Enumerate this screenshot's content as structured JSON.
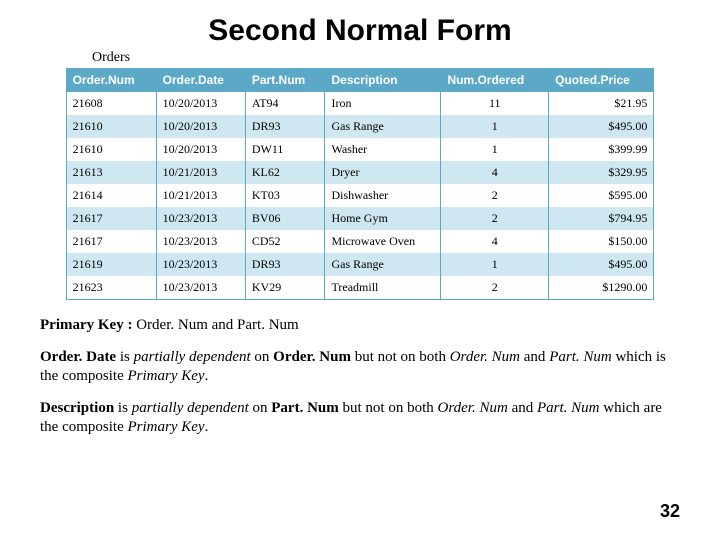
{
  "title": "Second Normal Form",
  "tableCaption": "Orders",
  "headers": [
    "Order.Num",
    "Order.Date",
    "Part.Num",
    "Description",
    "Num.Ordered",
    "Quoted.Price"
  ],
  "rows": [
    {
      "orderNum": "21608",
      "orderDate": "10/20/2013",
      "partNum": "AT94",
      "description": "Iron",
      "numOrdered": "11",
      "quotedPrice": "$21.95"
    },
    {
      "orderNum": "21610",
      "orderDate": "10/20/2013",
      "partNum": "DR93",
      "description": "Gas Range",
      "numOrdered": "1",
      "quotedPrice": "$495.00"
    },
    {
      "orderNum": "21610",
      "orderDate": "10/20/2013",
      "partNum": "DW11",
      "description": "Washer",
      "numOrdered": "1",
      "quotedPrice": "$399.99"
    },
    {
      "orderNum": "21613",
      "orderDate": "10/21/2013",
      "partNum": "KL62",
      "description": "Dryer",
      "numOrdered": "4",
      "quotedPrice": "$329.95"
    },
    {
      "orderNum": "21614",
      "orderDate": "10/21/2013",
      "partNum": "KT03",
      "description": "Dishwasher",
      "numOrdered": "2",
      "quotedPrice": "$595.00"
    },
    {
      "orderNum": "21617",
      "orderDate": "10/23/2013",
      "partNum": "BV06",
      "description": "Home Gym",
      "numOrdered": "2",
      "quotedPrice": "$794.95"
    },
    {
      "orderNum": "21617",
      "orderDate": "10/23/2013",
      "partNum": "CD52",
      "description": "Microwave Oven",
      "numOrdered": "4",
      "quotedPrice": "$150.00"
    },
    {
      "orderNum": "21619",
      "orderDate": "10/23/2013",
      "partNum": "DR93",
      "description": "Gas Range",
      "numOrdered": "1",
      "quotedPrice": "$495.00"
    },
    {
      "orderNum": "21623",
      "orderDate": "10/23/2013",
      "partNum": "KV29",
      "description": "Treadmill",
      "numOrdered": "2",
      "quotedPrice": "$1290.00"
    }
  ],
  "p1": {
    "t1": "Primary Key :",
    "t2": " Order. Num and Part. Num"
  },
  "p2": {
    "t1": "Order. Date ",
    "t2": "is ",
    "t3": "partially dependent ",
    "t4": "on ",
    "t5": "Order. Num ",
    "t6": "but not on both ",
    "t7": "Order. Num ",
    "t8": "and ",
    "t9": "Part. Num ",
    "t10": "which is the composite ",
    "t11": "Primary Key",
    "t12": "."
  },
  "p3": {
    "t1": "Description ",
    "t2": "is ",
    "t3": "partially dependent ",
    "t4": "on ",
    "t5": "Part. Num ",
    "t6": "but not on both ",
    "t7": "Order. Num ",
    "t8": "and ",
    "t9": "Part. Num ",
    "t10": "which are the composite ",
    "t11": "Primary Key",
    "t12": "."
  },
  "pageNumber": "32"
}
